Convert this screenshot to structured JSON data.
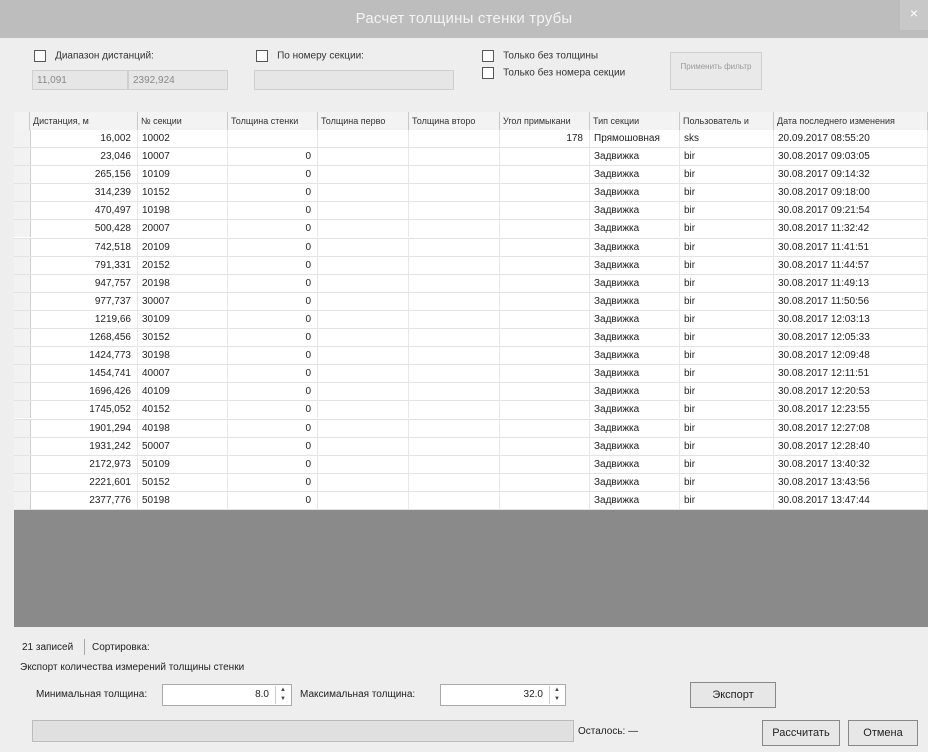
{
  "window": {
    "title": "Расчет толщины стенки трубы",
    "close_glyph": "×"
  },
  "filters": {
    "distance_range": {
      "label": "Диапазон дистанций:",
      "from": "11,091",
      "to": "2392,924",
      "checked": false
    },
    "by_section": {
      "label": "По номеру секции:",
      "value": "",
      "checked": false
    },
    "only_without_thickness": {
      "label": "Только без толщины",
      "checked": false
    },
    "only_without_section": {
      "label": "Только без номера секции",
      "checked": false
    },
    "apply_button": "Применить фильтр"
  },
  "table": {
    "columns": [
      "Дистанция, м",
      "№ секции",
      "Толщина стенки",
      "Толщина перво",
      "Толщина второ",
      "Угол примыкани",
      "Тип секции",
      "Пользователь и",
      "Дата последнего изменения"
    ],
    "rows": [
      [
        "16,002",
        "10002",
        "",
        "",
        "",
        "178",
        "Прямошовная",
        "sks",
        "20.09.2017 08:55:20"
      ],
      [
        "23,046",
        "10007",
        "0",
        "",
        "",
        "",
        "Задвижка",
        "bir",
        "30.08.2017 09:03:05"
      ],
      [
        "265,156",
        "10109",
        "0",
        "",
        "",
        "",
        "Задвижка",
        "bir",
        "30.08.2017 09:14:32"
      ],
      [
        "314,239",
        "10152",
        "0",
        "",
        "",
        "",
        "Задвижка",
        "bir",
        "30.08.2017 09:18:00"
      ],
      [
        "470,497",
        "10198",
        "0",
        "",
        "",
        "",
        "Задвижка",
        "bir",
        "30.08.2017 09:21:54"
      ],
      [
        "500,428",
        "20007",
        "0",
        "",
        "",
        "",
        "Задвижка",
        "bir",
        "30.08.2017 11:32:42"
      ],
      [
        "742,518",
        "20109",
        "0",
        "",
        "",
        "",
        "Задвижка",
        "bir",
        "30.08.2017 11:41:51"
      ],
      [
        "791,331",
        "20152",
        "0",
        "",
        "",
        "",
        "Задвижка",
        "bir",
        "30.08.2017 11:44:57"
      ],
      [
        "947,757",
        "20198",
        "0",
        "",
        "",
        "",
        "Задвижка",
        "bir",
        "30.08.2017 11:49:13"
      ],
      [
        "977,737",
        "30007",
        "0",
        "",
        "",
        "",
        "Задвижка",
        "bir",
        "30.08.2017 11:50:56"
      ],
      [
        "1219,66",
        "30109",
        "0",
        "",
        "",
        "",
        "Задвижка",
        "bir",
        "30.08.2017 12:03:13"
      ],
      [
        "1268,456",
        "30152",
        "0",
        "",
        "",
        "",
        "Задвижка",
        "bir",
        "30.08.2017 12:05:33"
      ],
      [
        "1424,773",
        "30198",
        "0",
        "",
        "",
        "",
        "Задвижка",
        "bir",
        "30.08.2017 12:09:48"
      ],
      [
        "1454,741",
        "40007",
        "0",
        "",
        "",
        "",
        "Задвижка",
        "bir",
        "30.08.2017 12:11:51"
      ],
      [
        "1696,426",
        "40109",
        "0",
        "",
        "",
        "",
        "Задвижка",
        "bir",
        "30.08.2017 12:20:53"
      ],
      [
        "1745,052",
        "40152",
        "0",
        "",
        "",
        "",
        "Задвижка",
        "bir",
        "30.08.2017 12:23:55"
      ],
      [
        "1901,294",
        "40198",
        "0",
        "",
        "",
        "",
        "Задвижка",
        "bir",
        "30.08.2017 12:27:08"
      ],
      [
        "1931,242",
        "50007",
        "0",
        "",
        "",
        "",
        "Задвижка",
        "bir",
        "30.08.2017 12:28:40"
      ],
      [
        "2172,973",
        "50109",
        "0",
        "",
        "",
        "",
        "Задвижка",
        "bir",
        "30.08.2017 13:40:32"
      ],
      [
        "2221,601",
        "50152",
        "0",
        "",
        "",
        "",
        "Задвижка",
        "bir",
        "30.08.2017 13:43:56"
      ],
      [
        "2377,776",
        "50198",
        "0",
        "",
        "",
        "",
        "Задвижка",
        "bir",
        "30.08.2017 13:47:44"
      ]
    ]
  },
  "status": {
    "records": "21 записей",
    "sorting": "Сортировка:"
  },
  "export": {
    "caption": "Экспорт количества измерений толщины стенки",
    "min_label": "Минимальная толщина:",
    "min_value": "8.0",
    "max_label": "Максимальная толщина:",
    "max_value": "32.0",
    "button": "Экспорт"
  },
  "footer": {
    "remaining": "Осталось: —",
    "calc_button": "Рассчитать",
    "cancel_button": "Отмена",
    "progress": 0
  }
}
